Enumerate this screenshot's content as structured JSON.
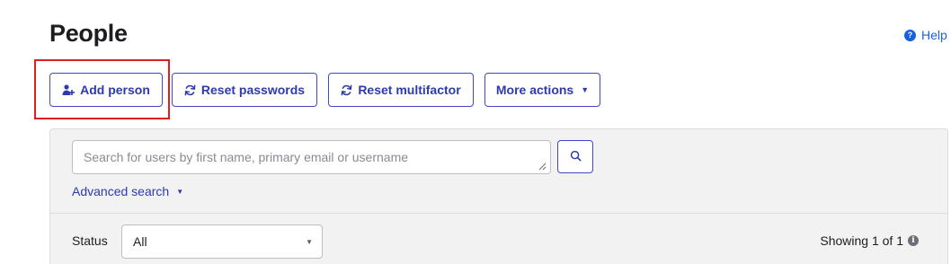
{
  "header": {
    "title": "People",
    "help_label": "Help",
    "help_icon": "question-circle-icon"
  },
  "toolbar": {
    "add_person": {
      "label": "Add person",
      "icon": "add-person-icon"
    },
    "reset_passwords": {
      "label": "Reset passwords",
      "icon": "refresh-icon"
    },
    "reset_multifactor": {
      "label": "Reset multifactor",
      "icon": "refresh-icon"
    },
    "more_actions": {
      "label": "More actions",
      "icon": "caret-down-icon"
    }
  },
  "search": {
    "placeholder": "Search for users by first name, primary email or username",
    "value": "",
    "button_icon": "search-icon",
    "advanced_label": "Advanced search"
  },
  "filters": {
    "status_label": "Status",
    "status_value": "All"
  },
  "pagination": {
    "showing_text": "Showing 1 of 1"
  },
  "colors": {
    "accent": "#2d3aaf",
    "link": "#1662dd",
    "highlight": "#e01e1e",
    "panel_bg": "#f2f2f2"
  }
}
